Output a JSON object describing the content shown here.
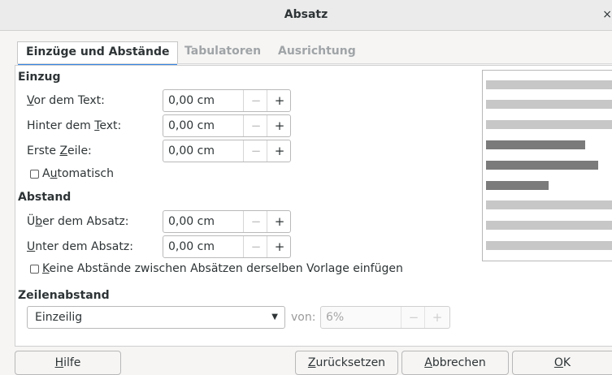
{
  "dialog": {
    "title": "Absatz",
    "close_glyph": "×"
  },
  "tabs": [
    {
      "label": "Einzüge und Abstände",
      "active": true
    },
    {
      "label": "Tabulatoren",
      "active": false
    },
    {
      "label": "Ausrichtung",
      "active": false
    }
  ],
  "einzug": {
    "heading": "Einzug",
    "vor": {
      "label_u": "V",
      "label_rest": "or dem Text:",
      "value": "0,00 cm"
    },
    "hinter": {
      "label_pre": "Hinter dem ",
      "label_u": "T",
      "label_rest": "ext:",
      "value": "0,00 cm"
    },
    "erste": {
      "label_pre": "Erste ",
      "label_u": "Z",
      "label_rest": "eile:",
      "value": "0,00 cm"
    },
    "auto": {
      "label_pre": "A",
      "label_u": "u",
      "label_rest": "tomatisch",
      "checked": false
    }
  },
  "abstand": {
    "heading": "Abstand",
    "ueber": {
      "label_pre": "Ü",
      "label_u": "b",
      "label_rest": "er dem Absatz:",
      "value": "0,00 cm"
    },
    "unter": {
      "label_u": "U",
      "label_rest": "nter dem Absatz:",
      "value": "0,00 cm"
    },
    "keine": {
      "label_u": "K",
      "label_rest": "eine Abstände zwischen Absätzen derselben Vorlage einfügen",
      "checked": false
    }
  },
  "zeilenabstand": {
    "heading": "Zeilenabstand",
    "selected": "Einzeilig",
    "von_label": "von:",
    "von_value": "6%"
  },
  "spin_symbols": {
    "minus": "−",
    "plus": "+"
  },
  "buttons": {
    "hilfe": {
      "u": "H",
      "rest": "ilfe"
    },
    "zuruecksetzen": {
      "u": "Z",
      "rest": "urücksetzen"
    },
    "abbrechen": {
      "u": "A",
      "rest": "bbrechen"
    },
    "ok": {
      "u": "O",
      "rest": "K"
    }
  },
  "colors": {
    "accent": "#3584e4",
    "preview_light": "#c7c7c7",
    "preview_dark": "#7b7b7b"
  }
}
